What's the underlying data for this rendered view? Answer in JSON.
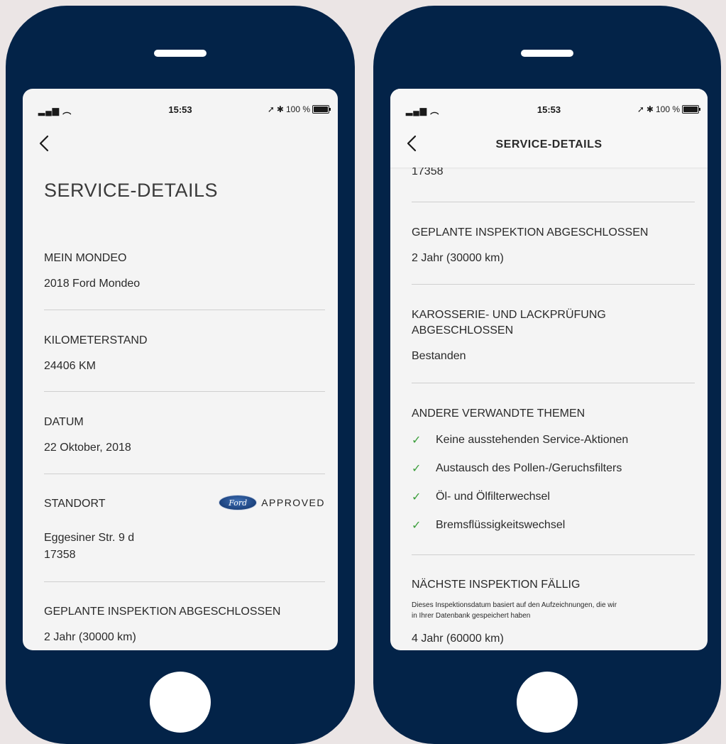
{
  "status": {
    "time": "15:53",
    "battery": "100 %",
    "signal_icon": "signal-wifi-icon"
  },
  "left_screen": {
    "title": "SERVICE-DETAILS",
    "sections": [
      {
        "label": "MEIN MONDEO",
        "value": "2018 Ford Mondeo"
      },
      {
        "label": "KILOMETERSTAND",
        "value": "24406 KM"
      },
      {
        "label": "DATUM",
        "value": "22 Oktober, 2018"
      },
      {
        "label": "STANDORT",
        "value_line1": "Eggesiner Str. 9 d",
        "value_line2": "17358",
        "badge_logo": "Ford",
        "badge_text": "APPROVED"
      },
      {
        "label": "GEPLANTE INSPEKTION ABGESCHLOSSEN",
        "value": "2 Jahr (30000 km)"
      }
    ]
  },
  "right_screen": {
    "header_title": "SERVICE-DETAILS",
    "scrolled_value": "17358",
    "inspection": {
      "label": "GEPLANTE INSPEKTION ABGESCHLOSSEN",
      "value": "2 Jahr (30000 km)"
    },
    "body_paint": {
      "label_line1": "KAROSSERIE- UND LACKPRÜFUNG",
      "label_line2": "ABGESCHLOSSEN",
      "value": "Bestanden"
    },
    "related": {
      "label": "ANDERE VERWANDTE THEMEN",
      "items": [
        "Keine ausstehenden Service-Aktionen",
        "Austausch des Pollen-/Geruchsfilters",
        "Öl- und Ölfilterwechsel",
        "Bremsflüssigkeitswechsel"
      ]
    },
    "next_inspection": {
      "label": "NÄCHSTE INSPEKTION FÄLLIG",
      "note_line1": "Dieses Inspektionsdatum basiert auf den Aufzeichnungen, die wir",
      "note_line2": "in Ihrer Datenbank gespeichert haben",
      "value": "4 Jahr (60000 km)"
    }
  },
  "colors": {
    "phone_frame": "#032348",
    "background": "#ebe5e5",
    "check": "#3b9e3b"
  }
}
